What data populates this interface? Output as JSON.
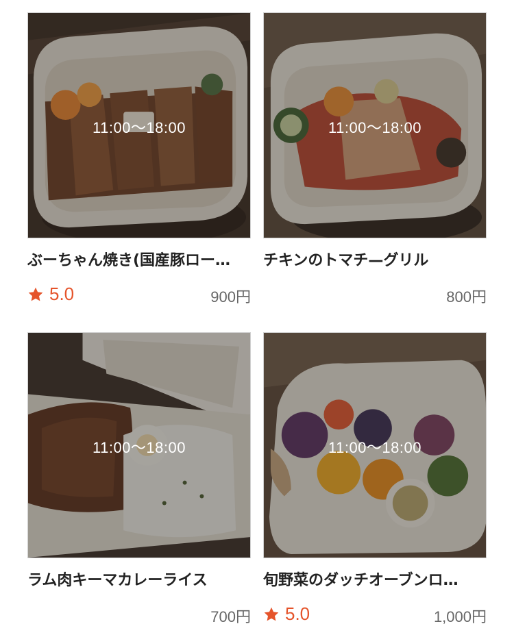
{
  "items": [
    {
      "hours": "11:00〜18:00",
      "name": "ぶーちゃん焼き(国産豚ロー…",
      "rating": "5.0",
      "price": "900円"
    },
    {
      "hours": "11:00〜18:00",
      "name": "チキンのトマチ—グリル",
      "rating": "",
      "price": "800円"
    },
    {
      "hours": "11:00〜18:00",
      "name": "ラム肉キーマカレーライス",
      "rating": "",
      "price": "700円"
    },
    {
      "hours": "11:00〜18:00",
      "name": "旬野菜のダッチオーブンロ…",
      "rating": "5.0",
      "price": "1,000円"
    }
  ],
  "colors": {
    "accent": "#e5542b",
    "price": "#666666"
  },
  "icons": {
    "rating": "star-icon"
  }
}
